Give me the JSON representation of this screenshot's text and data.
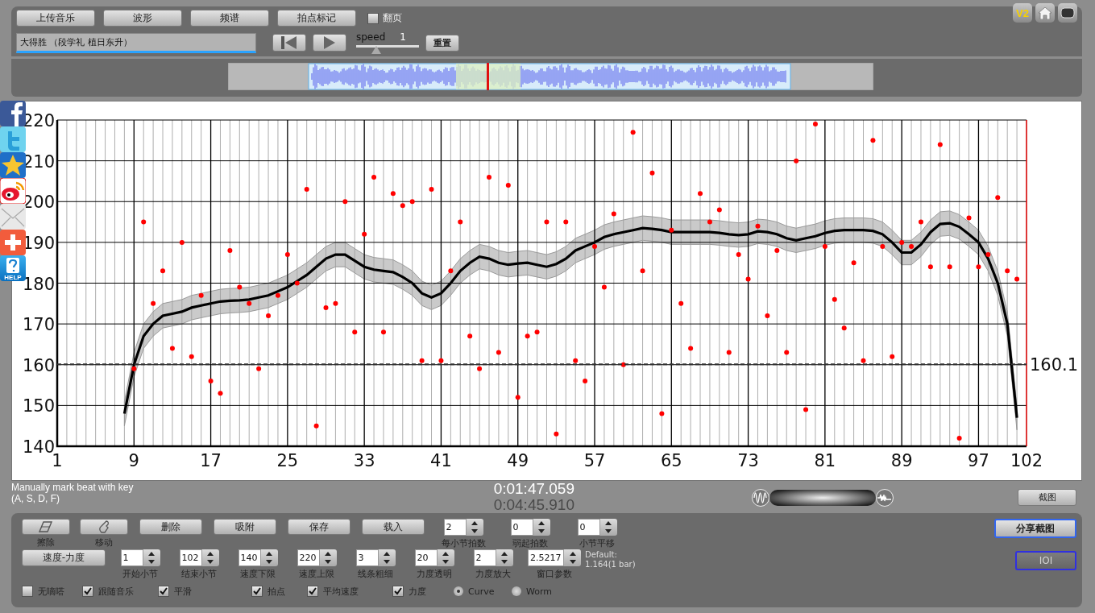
{
  "toolbar": {
    "buttons": [
      "上传音乐",
      "波形",
      "频谱",
      "拍点标记"
    ],
    "page_flip": {
      "label": "翻页",
      "checked": false
    },
    "song": {
      "value": "大得胜 （段学礼 植日东升）"
    },
    "speed": {
      "label": "speed",
      "value": "1",
      "level": 0.32
    },
    "reset_button": "重置",
    "version_badge": "V2"
  },
  "share_icons": {
    "help_label": "HELP"
  },
  "chart": {
    "chart_data": {
      "type": "scatter",
      "x": [
        1,
        2,
        3,
        4,
        5,
        6,
        7,
        8,
        9,
        10,
        11,
        12,
        13,
        14,
        15,
        16,
        17,
        18,
        19,
        20,
        21,
        22,
        23,
        24,
        25,
        26,
        27,
        28,
        29,
        30,
        31,
        32,
        33,
        34,
        35,
        36,
        37,
        38,
        39,
        40,
        41,
        42,
        43,
        44,
        45,
        46,
        47,
        48,
        49,
        50,
        51,
        52,
        53,
        54,
        55,
        56,
        57,
        58,
        59,
        60,
        61,
        62,
        63,
        64,
        65,
        66,
        67,
        68,
        69,
        70,
        71,
        72,
        73,
        74,
        75,
        76,
        77,
        78,
        79,
        80,
        81,
        82,
        83,
        84,
        85,
        86,
        87,
        88,
        89,
        90,
        91,
        92,
        93,
        94,
        95,
        96,
        97,
        98,
        99,
        100,
        101,
        102
      ],
      "xlim": [
        1,
        102
      ],
      "ylim": [
        140,
        220
      ],
      "xticks": [
        1,
        9,
        17,
        25,
        33,
        41,
        49,
        57,
        65,
        73,
        81,
        89,
        97,
        102
      ],
      "yticks": [
        140,
        150,
        160,
        170,
        180,
        190,
        200,
        210,
        220
      ],
      "series": [
        {
          "type": "line",
          "line_style": "solid",
          "color": "#000000",
          "values": [
            null,
            null,
            null,
            null,
            null,
            null,
            null,
            148,
            160,
            167,
            170,
            172,
            172.5,
            173,
            174,
            174.5,
            175,
            175.5,
            175.7,
            175.8,
            176,
            176.5,
            177,
            178,
            179,
            180.5,
            182,
            184,
            186,
            187,
            187,
            185.5,
            184,
            183.3,
            183,
            182.7,
            181.5,
            180,
            177.5,
            176.5,
            177.5,
            180,
            183,
            185,
            186.5,
            186,
            185,
            184.5,
            184.8,
            185,
            184.5,
            184,
            184.7,
            186,
            188,
            189,
            190,
            191.3,
            192,
            192.5,
            193,
            193.5,
            193.3,
            193,
            192.5,
            192.5,
            192.5,
            192.5,
            192.5,
            192.3,
            192,
            191.8,
            192,
            192.7,
            192.5,
            192,
            191,
            190.5,
            191,
            191.5,
            192.3,
            192.8,
            193,
            193,
            193,
            192.8,
            192,
            190,
            187.5,
            187.5,
            189.5,
            192.5,
            194.5,
            194.7,
            193.8,
            192,
            190,
            186,
            180,
            170,
            147,
            null
          ]
        },
        {
          "type": "scatter",
          "color": "#ff0000",
          "values": [
            null,
            null,
            null,
            null,
            null,
            null,
            null,
            null,
            159,
            195,
            175,
            183,
            164,
            190,
            162,
            177,
            156,
            153,
            188,
            179,
            175,
            159,
            172,
            177,
            187,
            180,
            203,
            145,
            174,
            175,
            200,
            168,
            192,
            206,
            168,
            202,
            199,
            200,
            161,
            203,
            161,
            183,
            195,
            167,
            159,
            206,
            163,
            204,
            152,
            167,
            168,
            195,
            143,
            195,
            161,
            156,
            189,
            179,
            197,
            160,
            217,
            183,
            207,
            148,
            193,
            175,
            164,
            202,
            195,
            198,
            163,
            187,
            181,
            194,
            172,
            188,
            163,
            210,
            149,
            219,
            189,
            176,
            169,
            185,
            161,
            215,
            189,
            162,
            190,
            189,
            195,
            184,
            214,
            184,
            142,
            196,
            184,
            187,
            201,
            183,
            181,
            null
          ]
        },
        {
          "type": "line",
          "line_style": "dashed",
          "color": "#333333",
          "values": [
            160.1,
            160.1,
            160.1,
            160.1,
            160.1,
            160.1,
            160.1,
            160.1,
            160.1,
            160.1,
            160.1,
            160.1,
            160.1,
            160.1,
            160.1,
            160.1,
            160.1,
            160.1,
            160.1,
            160.1,
            160.1,
            160.1,
            160.1,
            160.1,
            160.1,
            160.1,
            160.1,
            160.1,
            160.1,
            160.1,
            160.1,
            160.1,
            160.1,
            160.1,
            160.1,
            160.1,
            160.1,
            160.1,
            160.1,
            160.1,
            160.1,
            160.1,
            160.1,
            160.1,
            160.1,
            160.1,
            160.1,
            160.1,
            160.1,
            160.1,
            160.1,
            160.1,
            160.1,
            160.1,
            160.1,
            160.1,
            160.1,
            160.1,
            160.1,
            160.1,
            160.1,
            160.1,
            160.1,
            160.1,
            160.1,
            160.1,
            160.1,
            160.1,
            160.1,
            160.1,
            160.1,
            160.1,
            160.1,
            160.1,
            160.1,
            160.1,
            160.1,
            160.1,
            160.1,
            160.1,
            160.1,
            160.1,
            160.1,
            160.1,
            160.1,
            160.1,
            160.1,
            160.1,
            160.1,
            160.1,
            160.1,
            160.1,
            160.1,
            160.1,
            160.1,
            160.1,
            160.1,
            160.1,
            160.1,
            160.1,
            160.1,
            160.1
          ]
        }
      ],
      "annotations": [
        {
          "x": 102,
          "y": 160.1,
          "text": "160.1"
        }
      ]
    }
  },
  "hint": [
    "Manually mark beat with key",
    "(A, S, D, F)"
  ],
  "times": {
    "current": "0:01:47.059",
    "total": "0:04:45.910"
  },
  "screenshot_button": "截图",
  "tools": [
    {
      "label": "擦除",
      "kind": "eraser"
    },
    {
      "label": "移动",
      "kind": "hand"
    },
    {
      "label": "删除",
      "kind": "text"
    },
    {
      "label": "吸附",
      "kind": "text"
    },
    {
      "label": "保存",
      "kind": "text"
    },
    {
      "label": "载入",
      "kind": "text"
    }
  ],
  "spinners_row1": [
    {
      "value": "2",
      "label": "每小节拍数"
    },
    {
      "value": "0",
      "label": "弱起拍数"
    },
    {
      "value": "0",
      "label": "小节平移"
    }
  ],
  "mode_button": "速度-力度",
  "spinners_row2": [
    {
      "value": "1",
      "label": "开始小节"
    },
    {
      "value": "102",
      "label": "结束小节"
    },
    {
      "value": "140",
      "label": "速度下限"
    },
    {
      "value": "220",
      "label": "速度上限"
    },
    {
      "value": "3",
      "label": "线条粗细"
    },
    {
      "value": "20",
      "label": "力度透明"
    },
    {
      "value": "2",
      "label": "力度放大"
    },
    {
      "value": "2.5217",
      "label": "窗口参数"
    }
  ],
  "default_note": [
    "Default:",
    "1.164(1 bar)"
  ],
  "checks": [
    {
      "label": "无嘀嗒",
      "checked": false
    },
    {
      "label": "跟随音乐",
      "checked": true
    },
    {
      "label": "平滑",
      "checked": true
    },
    {
      "label": "拍点",
      "checked": true
    },
    {
      "label": "平均速度",
      "checked": true
    },
    {
      "label": "力度",
      "checked": true
    }
  ],
  "radios": [
    {
      "label": "Curve",
      "selected": true
    },
    {
      "label": "Worm",
      "selected": false
    }
  ],
  "share_button": "分享截图",
  "ioi_button": {
    "label": "IOI",
    "disabled": true
  }
}
